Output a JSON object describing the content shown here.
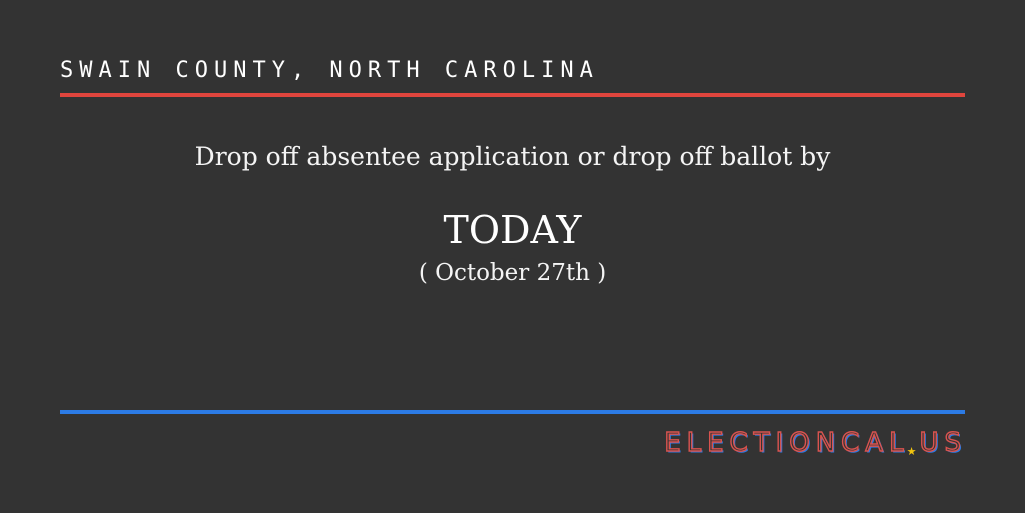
{
  "header": {
    "county": "SWAIN COUNTY, NORTH CAROLINA"
  },
  "message": {
    "instruction": "Drop off absentee application or drop off ballot by",
    "deadline_word": "TODAY",
    "deadline_date": "( October 27th )"
  },
  "brand": {
    "name_part1": "ELECTIONCAL",
    "name_part2": "US",
    "star_icon": "star-icon"
  },
  "colors": {
    "background": "#333333",
    "top_rule": "#e0453d",
    "bottom_rule": "#2c7be5",
    "star": "#f1c40f"
  }
}
